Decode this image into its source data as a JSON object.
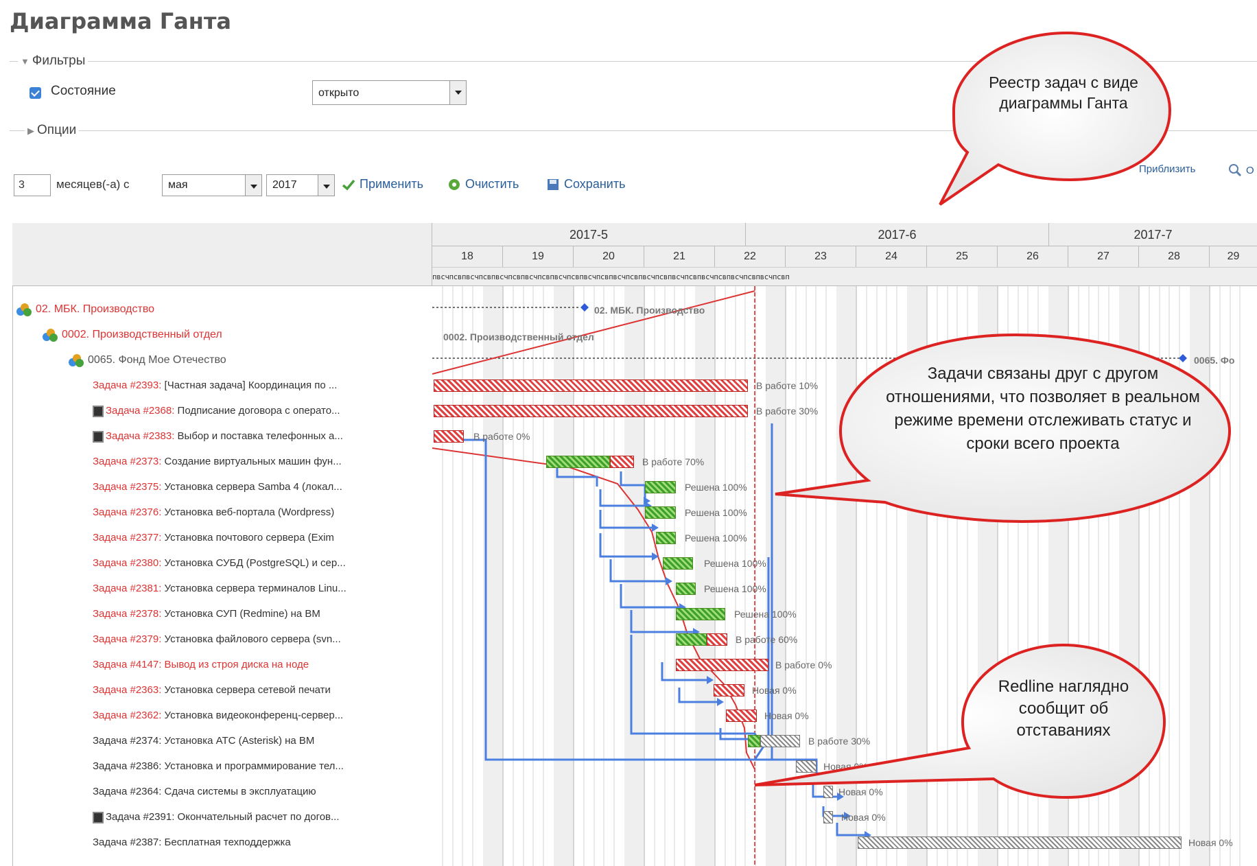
{
  "page": {
    "title": "Диаграмма Ганта"
  },
  "filters": {
    "legend": "Фильтры",
    "status_label": "Состояние",
    "status_value": "открыто",
    "options_legend": "Опции"
  },
  "period": {
    "months_value": "3",
    "months_label": "месяцев(-а) с",
    "month_value": "мая",
    "year_value": "2017",
    "apply": "Применить",
    "clear": "Очистить",
    "save": "Сохранить",
    "zoom_in": "Приблизить",
    "zoom_out": "О"
  },
  "timeline": {
    "months": [
      "2017-5",
      "2017-6",
      "2017-7"
    ],
    "weeks": [
      "18",
      "19",
      "20",
      "21",
      "22",
      "23",
      "24",
      "25",
      "26",
      "27",
      "28",
      "29"
    ],
    "day_letters": "пвсчпсвпвсчпсвпвсчпсвпвсчпсвпвсчпсвпвсчпсвпвсчпсвпвсчпсвпвсчпсвпвсчпсвпвсчпсвпвсчпсвп"
  },
  "tree": {
    "project1": "02. МБК. Производство",
    "project2": "0002. Производственный отдел",
    "project3": "0065. Фонд Мое Отечество"
  },
  "tasks": [
    {
      "id": "Задача #2393:",
      "title": "[Частная задача] Координация по ...",
      "red": true,
      "sq": false
    },
    {
      "id": "Задача #2368:",
      "title": "Подписание договора с операто...",
      "red": true,
      "sq": true
    },
    {
      "id": "Задача #2383:",
      "title": "Выбор и поставка телефонных а...",
      "red": true,
      "sq": true
    },
    {
      "id": "Задача #2373:",
      "title": "Создание виртуальных машин фун...",
      "red": true,
      "sq": false
    },
    {
      "id": "Задача #2375:",
      "title": "Установка сервера Samba 4 (локал...",
      "red": true,
      "sq": false
    },
    {
      "id": "Задача #2376:",
      "title": "Установка веб-портала (Wordpress)",
      "red": true,
      "sq": false
    },
    {
      "id": "Задача #2377:",
      "title": "Установка почтового сервера (Exim",
      "red": true,
      "sq": false
    },
    {
      "id": "Задача #2380:",
      "title": "Установка СУБД (PostgreSQL) и сер...",
      "red": true,
      "sq": false
    },
    {
      "id": "Задача #2381:",
      "title": "Установка сервера терминалов Linu...",
      "red": true,
      "sq": false
    },
    {
      "id": "Задача #2378:",
      "title": "Установка СУП (Redmine) на ВМ",
      "red": true,
      "sq": false
    },
    {
      "id": "Задача #2379:",
      "title": "Установка файлового сервера (svn...",
      "red": true,
      "sq": false
    },
    {
      "id": "Задача #4147:",
      "title": "Вывод из строя диска на ноде",
      "red": true,
      "sq": false
    },
    {
      "id": "Задача #2363:",
      "title": "Установка сервера сетевой печати",
      "red": true,
      "sq": false
    },
    {
      "id": "Задача #2362:",
      "title": "Установка видеоконференц-сервер...",
      "red": true,
      "sq": false
    },
    {
      "id": "Задача #2374:",
      "title": "Установка АТС (Asterisk) на ВМ",
      "red": false,
      "sq": false
    },
    {
      "id": "Задача #2386:",
      "title": "Установка и программирование тел...",
      "red": false,
      "sq": false
    },
    {
      "id": "Задача #2364:",
      "title": "Сдача системы в эксплуатацию",
      "red": false,
      "sq": false
    },
    {
      "id": "Задача #2391:",
      "title": "Окончательный расчет по догов...",
      "red": false,
      "sq": true
    },
    {
      "id": "Задача #2387:",
      "title": "Бесплатная техподдержка",
      "red": false,
      "sq": false
    }
  ],
  "bars": [
    {
      "label": "В работе 10%"
    },
    {
      "label": "В работе 30%"
    },
    {
      "label": "В работе 0%"
    },
    {
      "label": "В работе 70%"
    },
    {
      "label": "Решена 100%"
    },
    {
      "label": "Решена 100%"
    },
    {
      "label": "Решена 100%"
    },
    {
      "label": "Решена 100%"
    },
    {
      "label": "Решена 100%"
    },
    {
      "label": "Решена 100%"
    },
    {
      "label": "В работе 60%"
    },
    {
      "label": "В работе 0%"
    },
    {
      "label": "Новая 0%"
    },
    {
      "label": "Новая 0%"
    },
    {
      "label": "В работе 30%"
    },
    {
      "label": "Новая 0%"
    },
    {
      "label": "Новая 0%"
    },
    {
      "label": "Новая 0%"
    },
    {
      "label": "Новая 0%"
    }
  ],
  "gantt_captions": {
    "project1": "02. МБК. Производство",
    "project2": "0002. Производственный отдел",
    "project3": "0065. Фо"
  },
  "callouts": {
    "top": "Реестр задач с виде диаграммы Ганта",
    "middle": "Задачи связаны друг с другом отношениями, что позволяет в реальном режиме времени отслеживать статус и сроки всего проекта",
    "bottom": "Redline наглядно сообщит об отставаниях"
  }
}
